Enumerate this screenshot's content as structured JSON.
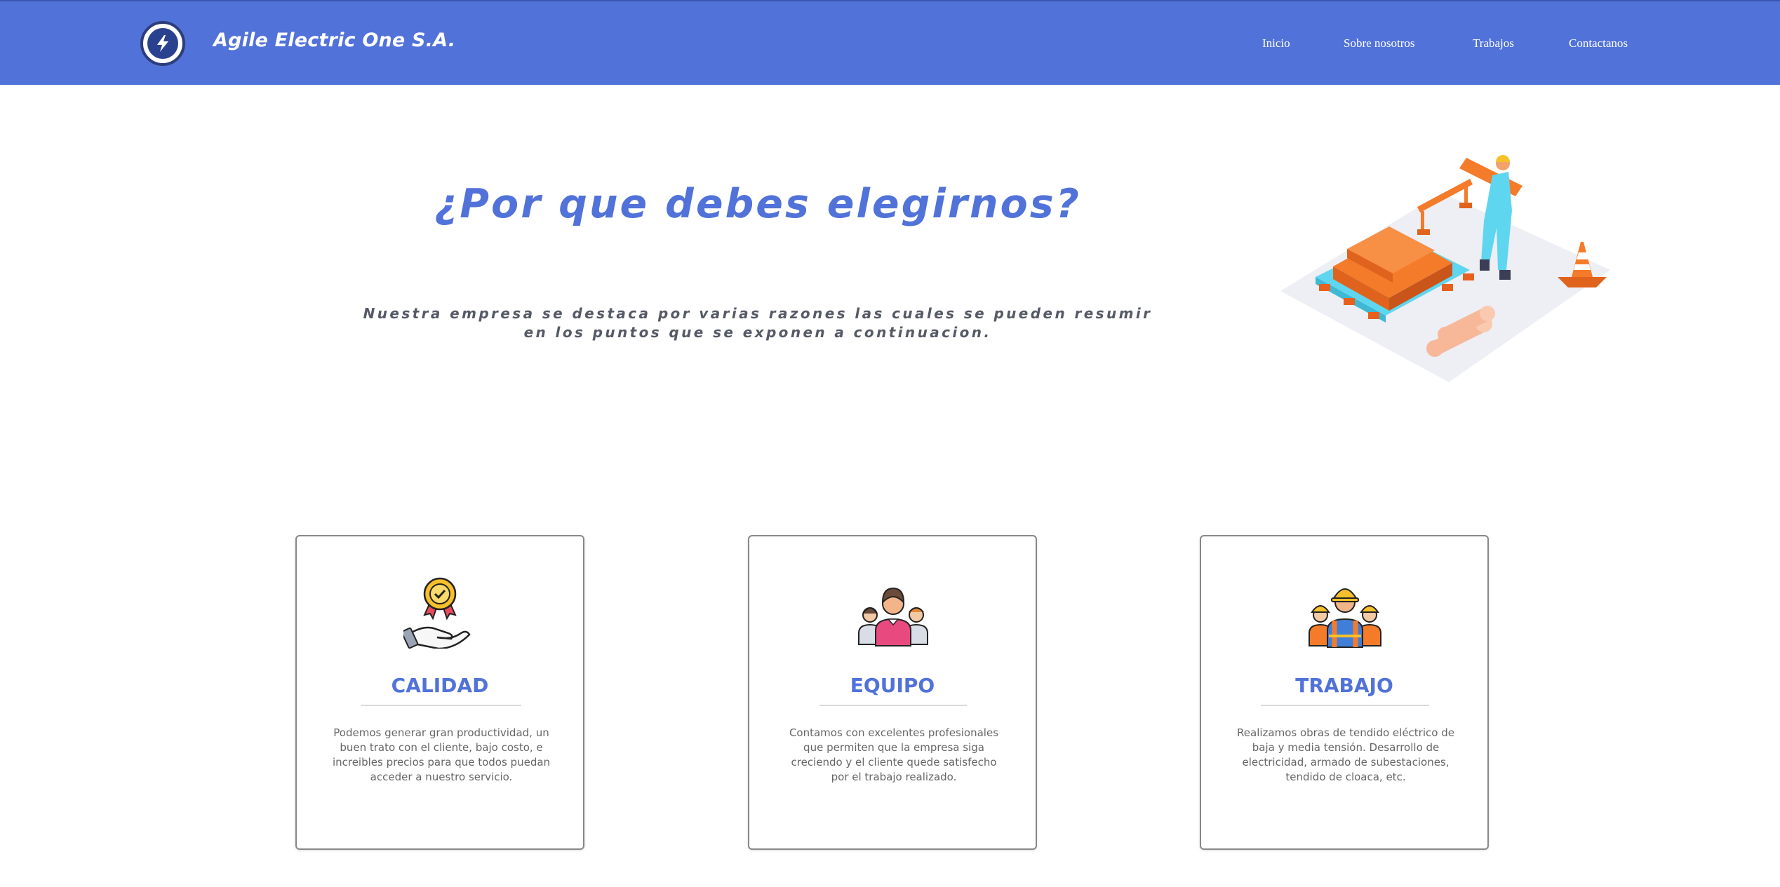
{
  "navbar": {
    "brand": "Agile Electric One S.A.",
    "logo_icon": "lightning-bolt-icon",
    "links": [
      "Inicio",
      "Sobre nosotros",
      "Trabajos",
      "Contactanos"
    ]
  },
  "hero": {
    "title": "¿Por que debes elegirnos?",
    "text": "Nuestra empresa se destaca por varias razones las cuales se pueden resumir en los puntos que se exponen a continuacion.",
    "illustration": "construction-worker-illustration"
  },
  "cards": [
    {
      "icon": "hand-award-icon",
      "title": "CALIDAD",
      "text": "Podemos generar gran productividad, un buen trato con el cliente, bajo costo, e increibles precios para que todos puedan acceder a nuestro servicio."
    },
    {
      "icon": "team-people-icon",
      "title": "EQUIPO",
      "text": "Contamos con excelentes profesionales que permiten que la empresa siga creciendo y el cliente quede satisfecho por el trabajo realizado."
    },
    {
      "icon": "construction-workers-icon",
      "title": "TRABAJO",
      "text": "Realizamos obras de tendido eléctrico de baja y media tensión. Desarrollo de electricidad, armado de subestaciones, tendido de cloaca, etc."
    }
  ],
  "colors": {
    "primary": "#5172d9",
    "text": "#555a66",
    "accent_orange": "#f47b2a",
    "accent_cyan": "#5fd6ef"
  }
}
